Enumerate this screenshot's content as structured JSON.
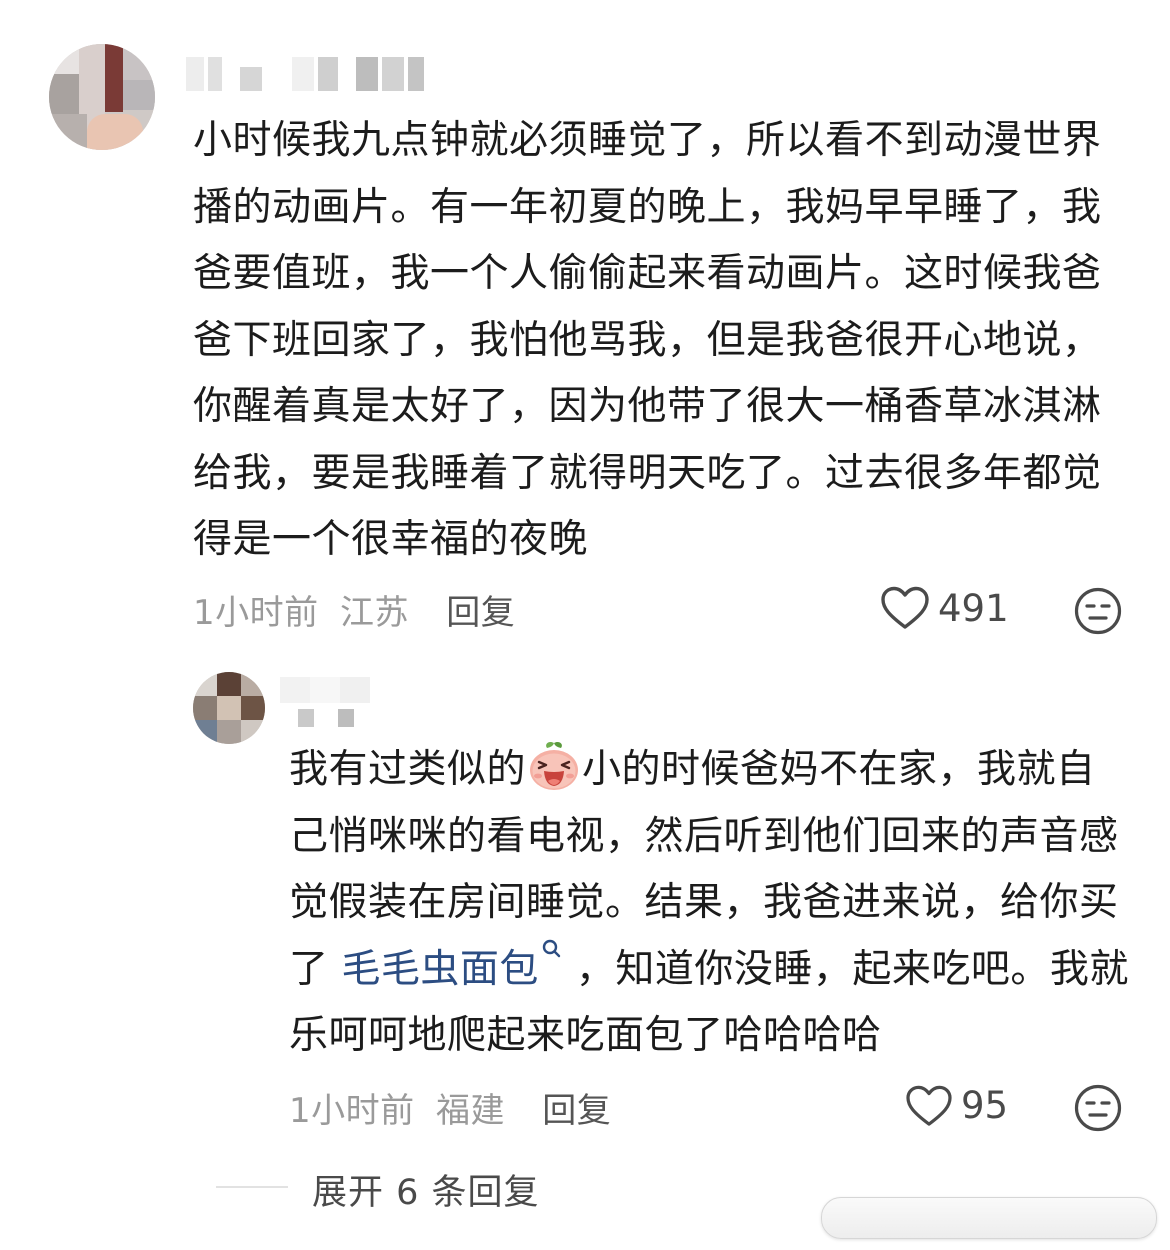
{
  "comment": {
    "text": "小时候我九点钟就必须睡觉了，所以看不到动漫世界播的动画片。有一年初夏的晚上，我妈早早睡了，我爸要值班，我一个人偷偷起来看动画片。这时候我爸爸下班回家了，我怕他骂我，但是我爸很开心地说，你醒着真是太好了，因为他带了很大一桶香草冰淇淋给我，要是我睡着了就得明天吃了。过去很多年都觉得是一个很幸福的夜晚",
    "time": "1小时前",
    "location": "江苏",
    "reply_label": "回复",
    "likes": "491"
  },
  "reply": {
    "text_before_emoji": "我有过类似的",
    "emoji_icon": "laughing-peach-emoji",
    "text_after_emoji": "小的时候爸妈不在家，我就自己悄咪咪的看电视，然后听到他们回来的声音感觉假装在房间睡觉。结果，我爸进来说，给你买了 ",
    "link_text": "毛毛虫面包",
    "text_after_link": " ，知道你没睡，起来吃吧。我就乐呵呵地爬起来吃面包了哈哈哈哈",
    "time": "1小时前",
    "location": "福建",
    "reply_label": "回复",
    "likes": "95"
  },
  "expand_replies_label": "展开 6 条回复",
  "colors": {
    "link": "#2c4d82",
    "meta": "#9a9a9a",
    "text": "#1c1c1c"
  }
}
